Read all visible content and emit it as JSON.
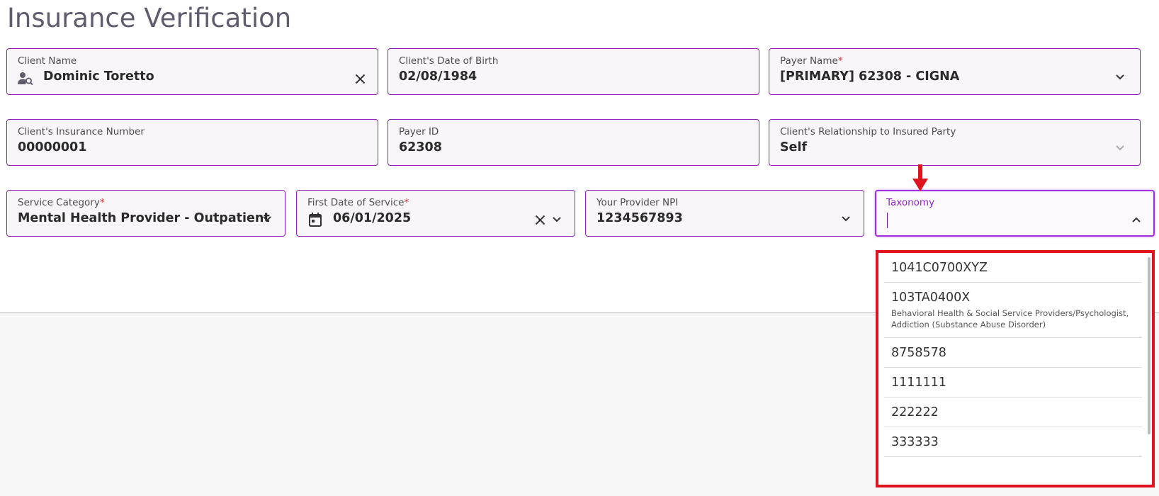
{
  "page": {
    "title": "Insurance Verification"
  },
  "fields": {
    "client_name": {
      "label": "Client Name",
      "value": "Dominic Toretto"
    },
    "dob": {
      "label": "Client's Date of Birth",
      "value": "02/08/1984"
    },
    "payer_name": {
      "label": "Payer Name",
      "required_mark": "*",
      "value": "[PRIMARY] 62308 - CIGNA"
    },
    "insurance_number": {
      "label": "Client's Insurance Number",
      "value": "00000001"
    },
    "payer_id": {
      "label": "Payer ID",
      "value": "62308"
    },
    "relationship": {
      "label": "Client's Relationship to Insured Party",
      "value": "Self"
    },
    "service_category": {
      "label": "Service Category",
      "required_mark": "*",
      "value": "Mental Health Provider - Outpatient"
    },
    "first_date_of_service": {
      "label": "First Date of Service",
      "required_mark": "*",
      "value": "06/01/2025"
    },
    "provider_npi": {
      "label": "Your Provider NPI",
      "value": "1234567893"
    },
    "taxonomy": {
      "label": "Taxonomy",
      "value": ""
    }
  },
  "taxonomy_options": [
    {
      "code": "1041C0700XYZ",
      "desc": ""
    },
    {
      "code": "103TA0400X",
      "desc": "Behavioral Health & Social Service Providers/Psychologist, Addiction (Substance Abuse Disorder)"
    },
    {
      "code": "8758578",
      "desc": ""
    },
    {
      "code": "1111111",
      "desc": ""
    },
    {
      "code": "222222",
      "desc": ""
    },
    {
      "code": "333333",
      "desc": ""
    }
  ],
  "colors": {
    "accent": "#8e1fb6",
    "highlight": "#e0141f",
    "title": "#615b6e"
  }
}
